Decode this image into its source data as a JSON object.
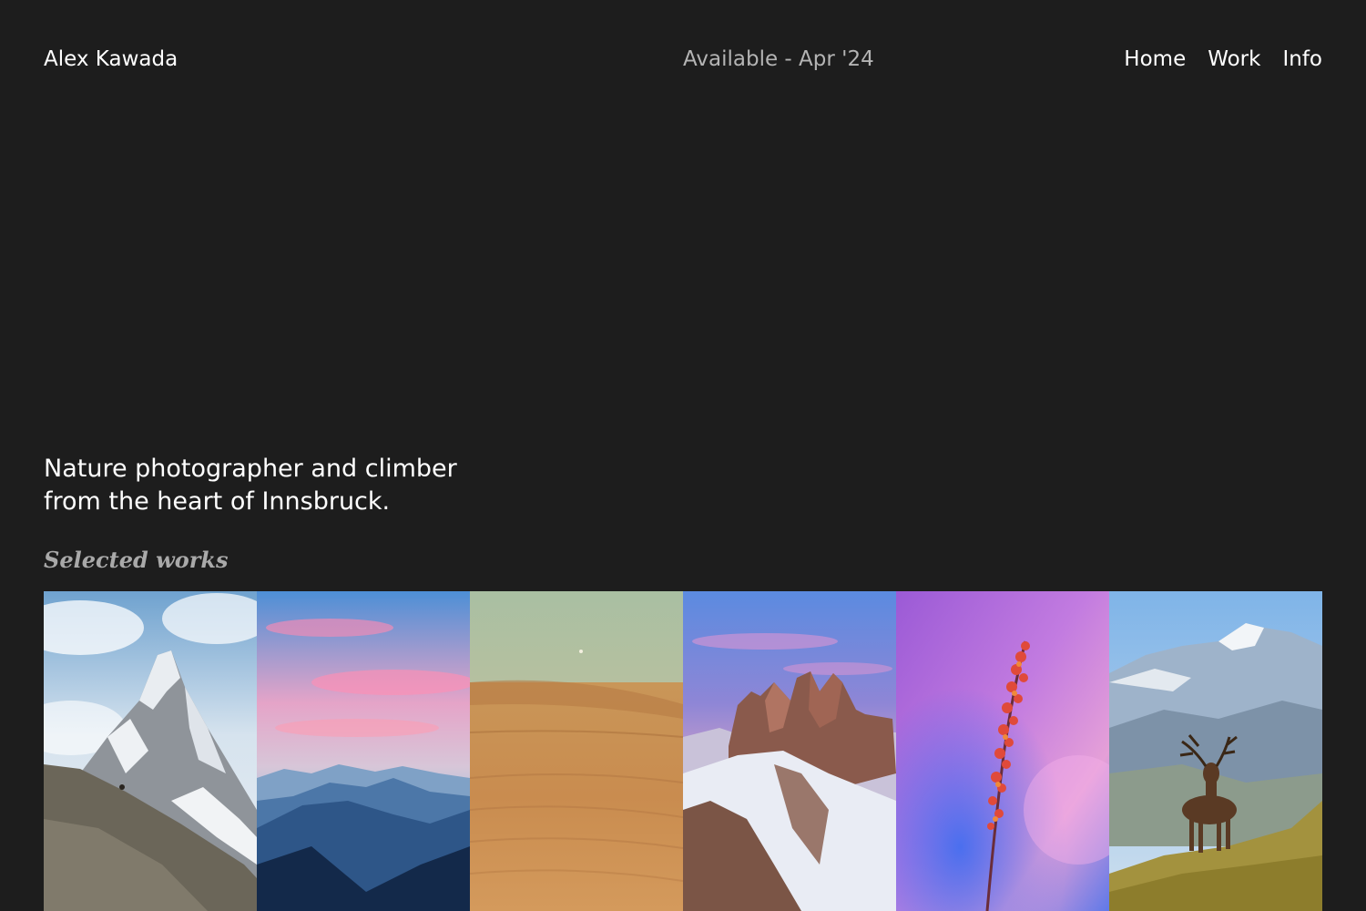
{
  "header": {
    "brand": "Alex Kawada",
    "availability": "Available - Apr '24",
    "nav": [
      "Home",
      "Work",
      "Info"
    ]
  },
  "intro": {
    "line1": "Nature photographer and climber",
    "line2": "from the heart of Innsbruck."
  },
  "works": {
    "title": "Selected works",
    "items": [
      "snowy-mountain-peak-with-chamois",
      "pink-sunset-over-blue-mountains",
      "desert-sand-dunes-with-moon",
      "dolomite-peaks-in-snow-at-dusk",
      "red-flower-stem-on-purple-background",
      "red-deer-stag-in-alpine-meadow"
    ]
  },
  "colors": {
    "background": "#1d1d1d",
    "text": "#ffffff",
    "muted": "#b4b4b4"
  }
}
